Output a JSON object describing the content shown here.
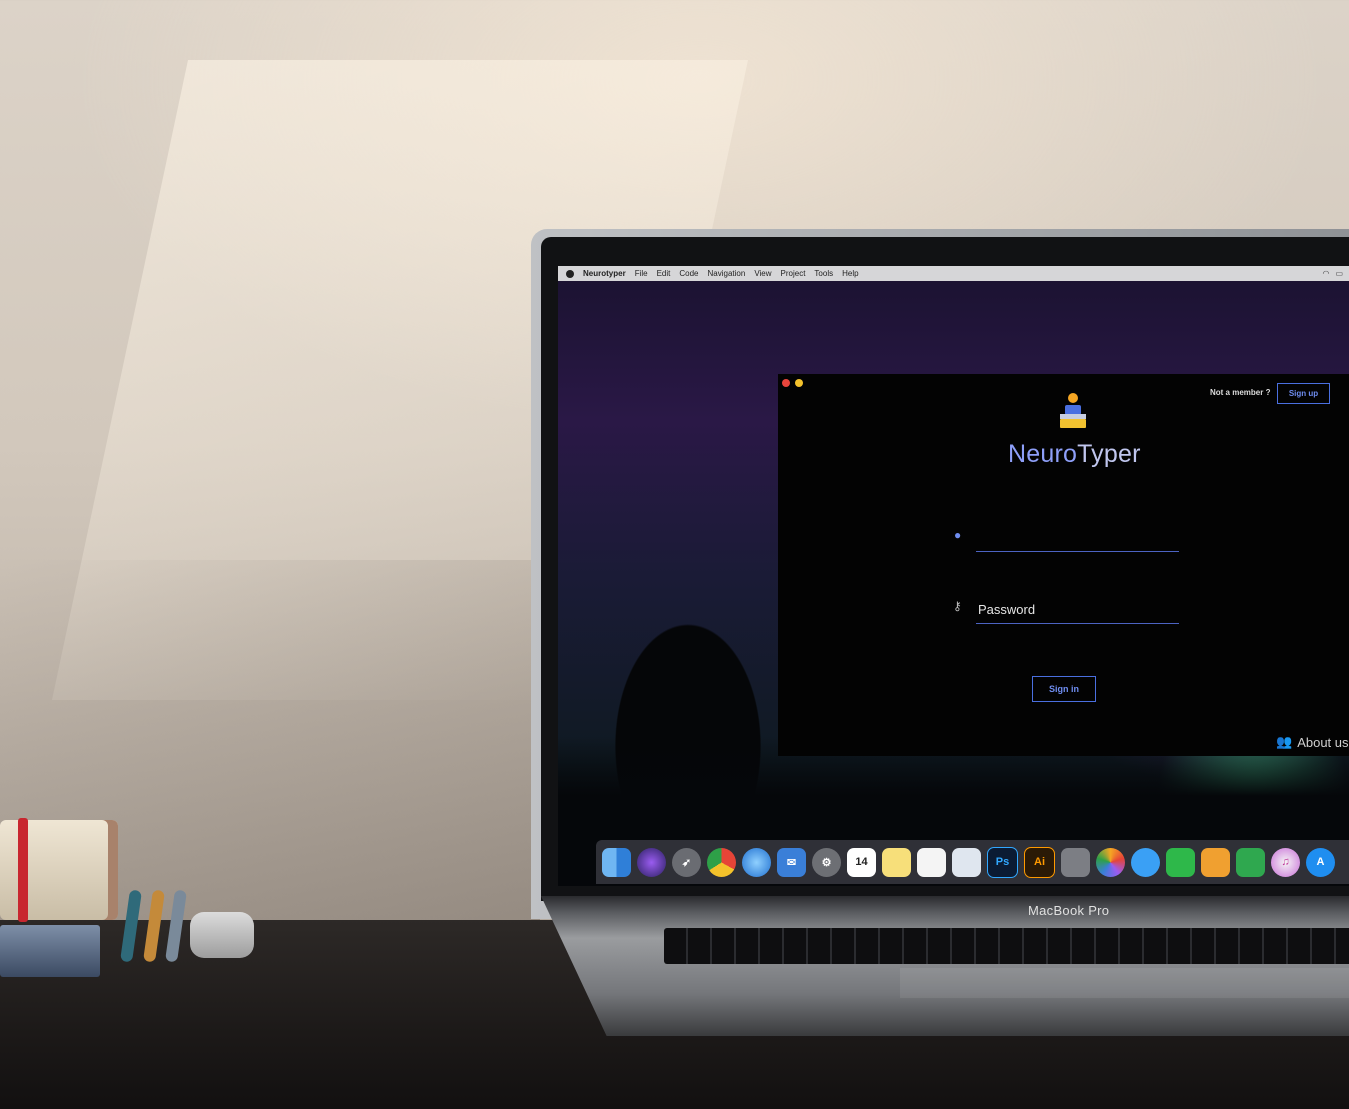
{
  "menubar": {
    "app_name": "Neurotyper",
    "items": [
      "File",
      "Edit",
      "Code",
      "Navigation",
      "View",
      "Project",
      "Tools",
      "Help"
    ]
  },
  "login_window": {
    "not_member_text": "Not a member ?",
    "signup_label": "Sign up",
    "brand": {
      "part1": "Neuro",
      "part2": "Typer"
    },
    "username": {
      "value": "",
      "icon": "user-icon"
    },
    "password": {
      "placeholder": "Password",
      "icon": "key-icon"
    },
    "signin_label": "Sign in",
    "about_label": "About us",
    "accent_color": "#4a6fe0"
  },
  "dock": {
    "icons": [
      "finder",
      "siri",
      "launchpad",
      "chrome",
      "safari",
      "mail",
      "system-preferences",
      "calendar",
      "notes",
      "reminders",
      "preview",
      "photoshop",
      "illustrator",
      "gimp",
      "photos",
      "messages",
      "facetime",
      "pages",
      "numbers",
      "itunes",
      "app-store"
    ],
    "calendar_day": "14",
    "ps_label": "Ps",
    "ai_label": "Ai"
  },
  "laptop": {
    "brand_label": "MacBook Pro"
  }
}
